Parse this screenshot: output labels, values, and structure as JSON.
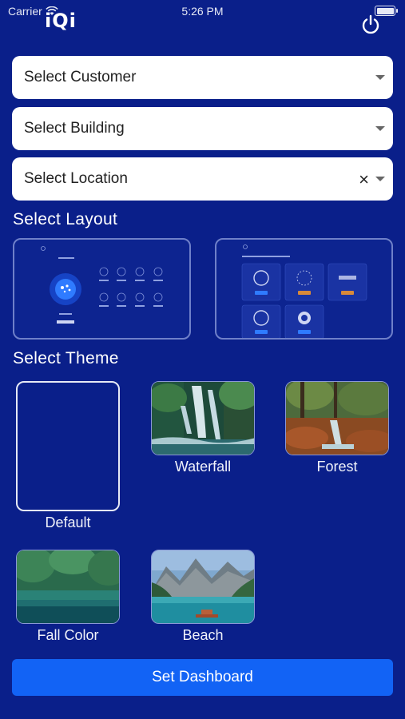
{
  "status_bar": {
    "carrier": "Carrier",
    "time": "5:26 PM"
  },
  "header": {
    "logo": "iQi"
  },
  "selects": {
    "customer": "Select Customer",
    "building": "Select Building",
    "location": "Select Location",
    "location_clear": "×"
  },
  "layout_section": {
    "title": "Select Layout"
  },
  "theme_section": {
    "title": "Select Theme",
    "themes": [
      {
        "label": "Default"
      },
      {
        "label": "Waterfall"
      },
      {
        "label": "Forest"
      },
      {
        "label": "Fall Color"
      },
      {
        "label": "Beach"
      }
    ]
  },
  "actions": {
    "set_dashboard": "Set Dashboard"
  },
  "colors": {
    "background": "#0a1f8a",
    "accent": "#1263f5"
  }
}
